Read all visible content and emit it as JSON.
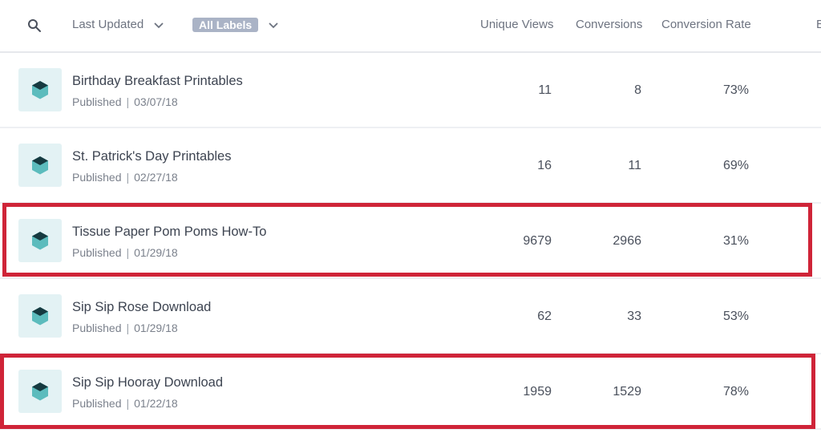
{
  "toolbar": {
    "search_icon": "search-icon",
    "sort_label": "Last Updated",
    "labels_filter": "All Labels"
  },
  "columns": {
    "unique_views": "Unique Views",
    "conversions": "Conversions",
    "conversion_rate": "Conversion Rate",
    "extra": "E"
  },
  "rows": [
    {
      "title": "Birthday Breakfast Printables",
      "status": "Published",
      "separator": "|",
      "date": "03/07/18",
      "unique_views": "11",
      "conversions": "8",
      "conversion_rate": "73%",
      "highlighted": false
    },
    {
      "title": "St. Patrick's Day Printables",
      "status": "Published",
      "separator": "|",
      "date": "02/27/18",
      "unique_views": "16",
      "conversions": "11",
      "conversion_rate": "69%",
      "highlighted": false
    },
    {
      "title": "Tissue Paper Pom Poms How-To",
      "status": "Published",
      "separator": "|",
      "date": "01/29/18",
      "unique_views": "9679",
      "conversions": "2966",
      "conversion_rate": "31%",
      "highlighted": true
    },
    {
      "title": "Sip Sip Rose Download",
      "status": "Published",
      "separator": "|",
      "date": "01/29/18",
      "unique_views": "62",
      "conversions": "33",
      "conversion_rate": "53%",
      "highlighted": false
    },
    {
      "title": "Sip Sip Hooray Download",
      "status": "Published",
      "separator": "|",
      "date": "01/22/18",
      "unique_views": "1959",
      "conversions": "1529",
      "conversion_rate": "78%",
      "highlighted": true
    }
  ],
  "colors": {
    "highlight": "#cf2438",
    "thumb_bg": "#e3f2f4",
    "cube_top": "#163a40",
    "cube_side": "#5cbcbd",
    "labels_pill": "#aab3c6"
  }
}
